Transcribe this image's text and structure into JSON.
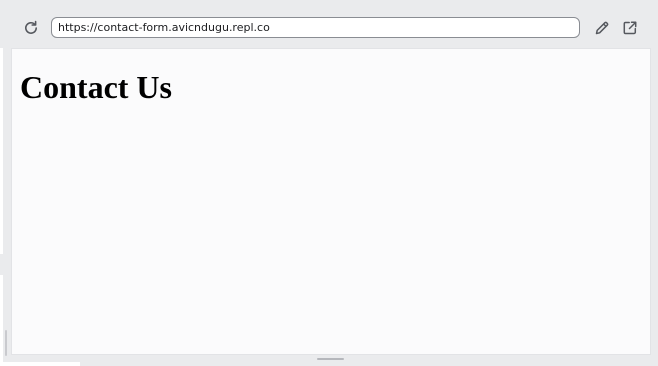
{
  "browser": {
    "url": "https://contact-form.avicndugu.repl.co",
    "icons": {
      "reload": "reload-icon",
      "edit": "pencil-icon",
      "external": "open-external-icon"
    }
  },
  "page": {
    "title": "Contact Us"
  },
  "colors": {
    "chrome_background": "#eaebed",
    "viewport_background": "#fbfbfc",
    "url_border": "#8a8d93",
    "icon_color": "#55585e"
  }
}
